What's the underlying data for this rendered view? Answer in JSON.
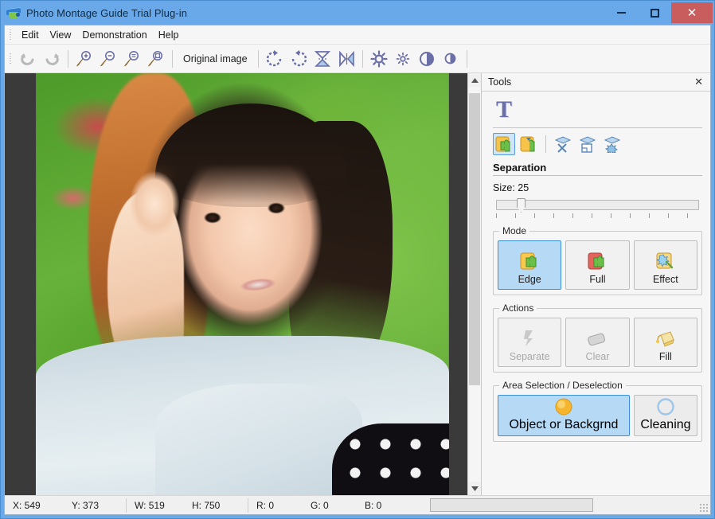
{
  "window": {
    "title": "Photo Montage Guide Trial Plug-in",
    "icon": "graduation-cap-icon",
    "buttons": {
      "minimize": "–",
      "maximize": "□",
      "close": "✕"
    },
    "accent_color": "#6aa9e9",
    "close_color": "#c95c5c"
  },
  "menubar": {
    "items": [
      {
        "label": "Edit"
      },
      {
        "label": "View"
      },
      {
        "label": "Demonstration"
      },
      {
        "label": "Help"
      }
    ]
  },
  "toolbar": {
    "original_image_label": "Original image",
    "buttons": [
      {
        "name": "undo-icon",
        "tooltip": "Undo"
      },
      {
        "name": "redo-icon",
        "tooltip": "Redo"
      },
      {
        "name": "zoom-in-icon",
        "tooltip": "Zoom In"
      },
      {
        "name": "zoom-out-icon",
        "tooltip": "Zoom Out"
      },
      {
        "name": "zoom-fit-icon",
        "tooltip": "Fit to Window"
      },
      {
        "name": "zoom-actual-icon",
        "tooltip": "Actual Size"
      },
      {
        "name": "rotate-cw-icon",
        "tooltip": "Rotate Clockwise"
      },
      {
        "name": "rotate-ccw-icon",
        "tooltip": "Rotate Counter-clockwise"
      },
      {
        "name": "flip-vertical-icon",
        "tooltip": "Flip Vertical"
      },
      {
        "name": "flip-horizontal-icon",
        "tooltip": "Flip Horizontal"
      },
      {
        "name": "brightness-icon",
        "tooltip": "Brightness"
      },
      {
        "name": "brightness-small-icon",
        "tooltip": "Brightness Fine"
      },
      {
        "name": "contrast-icon",
        "tooltip": "Contrast"
      },
      {
        "name": "contrast-small-icon",
        "tooltip": "Contrast Fine"
      }
    ]
  },
  "tools_panel": {
    "title": "Tools",
    "close_label": "✕",
    "logo": "T",
    "tool_icons": [
      {
        "name": "separation-tool-icon",
        "selected": true
      },
      {
        "name": "separation-alt-tool-icon",
        "selected": false
      },
      {
        "name": "guide-remove-icon",
        "selected": false
      },
      {
        "name": "guide-crop-icon",
        "selected": false
      },
      {
        "name": "guide-effect-icon",
        "selected": false
      }
    ],
    "separation": {
      "title": "Separation",
      "size_label": "Size: 25",
      "size_value": 25,
      "slider_percent": 12
    },
    "mode": {
      "legend": "Mode",
      "buttons": [
        {
          "label": "Edge",
          "icon": "edge-mode-icon",
          "state": "active"
        },
        {
          "label": "Full",
          "icon": "full-mode-icon",
          "state": "normal"
        },
        {
          "label": "Effect",
          "icon": "effect-mode-icon",
          "state": "normal"
        }
      ]
    },
    "actions": {
      "legend": "Actions",
      "buttons": [
        {
          "label": "Separate",
          "icon": "separate-icon",
          "state": "disabled"
        },
        {
          "label": "Clear",
          "icon": "eraser-icon",
          "state": "disabled"
        },
        {
          "label": "Fill",
          "icon": "paint-bucket-icon",
          "state": "normal"
        }
      ]
    },
    "area_selection": {
      "legend": "Area Selection / Deselection",
      "buttons": [
        {
          "label": "Object or Backgrnd",
          "icon": "filled-circle-icon",
          "state": "active"
        },
        {
          "label": "Cleaning",
          "icon": "outline-circle-icon",
          "state": "normal"
        }
      ]
    }
  },
  "canvas": {
    "scrollbar": {
      "up_glyph": "▲",
      "down_glyph": "▼",
      "thumb_percent": 74
    },
    "image_alt": "Portrait photo of a young woman with long dark hair in a light blue sweater and black polka-dot skirt sitting on green grass"
  },
  "statusbar": {
    "x": "X: 549",
    "y": "Y: 373",
    "w": "W: 519",
    "h": "H: 750",
    "r": "R: 0",
    "g": "G: 0",
    "b": "B: 0"
  }
}
